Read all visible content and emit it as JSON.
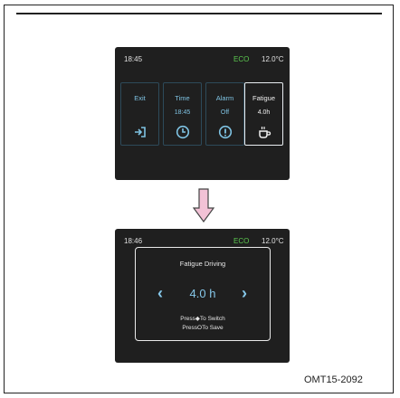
{
  "screen_menu": {
    "status_time": "18:45",
    "status_mode": "ECO",
    "status_temp": "12.0°C",
    "tiles": [
      {
        "label": "Exit",
        "value": "",
        "icon": "exit-icon"
      },
      {
        "label": "Time",
        "value": "18:45",
        "icon": "clock-icon"
      },
      {
        "label": "Alarm",
        "value": "Off",
        "icon": "alarm-icon"
      },
      {
        "label": "Fatigue",
        "value": "4.0h",
        "icon": "coffee-cup-icon"
      }
    ],
    "selected_tile": "Fatigue"
  },
  "screen_dialog": {
    "status_time": "18:46",
    "status_mode": "ECO",
    "status_temp": "12.0°C",
    "title": "Fatigue Driving",
    "value": "4.0 h",
    "hint_switch": "Press◆To Switch",
    "hint_save": "PressOTo Save"
  },
  "figure_code": "OMT15-2092",
  "colors": {
    "accent": "#86c8ea",
    "eco": "#5cc84f",
    "arrow_fill": "#f2c2d6",
    "arrow_stroke": "#444444"
  }
}
